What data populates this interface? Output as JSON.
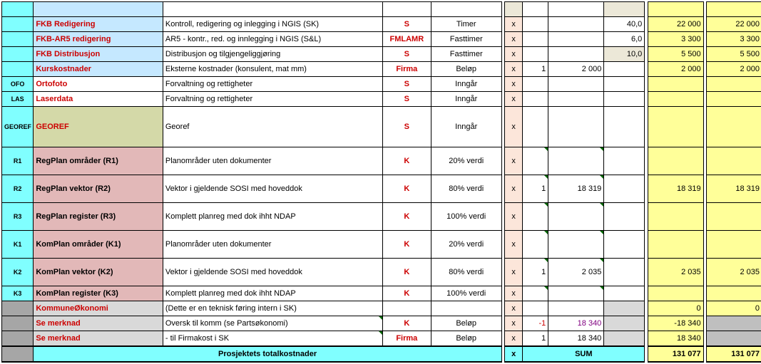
{
  "rows": [
    {
      "code": "",
      "codeBg": "bg-cyan",
      "name": "",
      "nameBg": "bg-lblue",
      "nameRed": false,
      "desc": "",
      "who": "",
      "unit": "",
      "x": "",
      "xBg": "bg-cream",
      "n1": "",
      "n2": "",
      "n3": "",
      "n3Bg": "bg-cream",
      "n4": "",
      "n4Bg": "bg-yellow",
      "n5": "",
      "n5Bg": "bg-yellow",
      "h": ""
    },
    {
      "code": "",
      "codeBg": "bg-cyan",
      "name": "FKB Redigering",
      "nameBg": "bg-lblue",
      "nameRed": true,
      "desc": "Kontroll, redigering og inlegging i NGIS (SK)",
      "who": "S",
      "unit": "Timer",
      "x": "x",
      "xBg": "bg-peach",
      "n1": "",
      "n2": "",
      "n3": "40,0",
      "n3Bg": "bg-white",
      "n4": "22 000",
      "n4Bg": "bg-yellow",
      "n5": "22 000",
      "n5Bg": "bg-yellow",
      "h": ""
    },
    {
      "code": "",
      "codeBg": "bg-cyan",
      "name": "FKB-AR5 redigering",
      "nameBg": "bg-lblue",
      "nameRed": true,
      "desc": "AR5 - kontr., red. og innlegging i NGIS (S&L)",
      "who": "FMLAMR",
      "unit": "Fasttimer",
      "x": "x",
      "xBg": "bg-peach",
      "n1": "",
      "n2": "",
      "n3": "6,0",
      "n3Bg": "bg-white",
      "n4": "3 300",
      "n4Bg": "bg-yellow",
      "n5": "3 300",
      "n5Bg": "bg-yellow",
      "h": ""
    },
    {
      "code": "",
      "codeBg": "bg-cyan",
      "name": "FKB Distribusjon",
      "nameBg": "bg-lblue",
      "nameRed": true,
      "desc": "Distribusjon og tilgjengeliggjøring",
      "who": "S",
      "unit": "Fasttimer",
      "x": "x",
      "xBg": "bg-peach",
      "n1": "",
      "n2": "",
      "n3": "10,0",
      "n3Bg": "bg-cream",
      "n4": "5 500",
      "n4Bg": "bg-yellow",
      "n5": "5 500",
      "n5Bg": "bg-yellow",
      "h": ""
    },
    {
      "code": "",
      "codeBg": "bg-cyan",
      "name": "Kurskostnader",
      "nameBg": "bg-lblue",
      "nameRed": true,
      "desc": "Eksterne kostnader (konsulent, mat mm)",
      "who": "Firma",
      "unit": "Beløp",
      "x": "x",
      "xBg": "bg-peach",
      "n1": "1",
      "n2": "2 000",
      "n3": "",
      "n3Bg": "bg-white",
      "n4": "2 000",
      "n4Bg": "bg-yellow",
      "n5": "2 000",
      "n5Bg": "bg-yellow",
      "h": ""
    },
    {
      "code": "OFO",
      "codeBg": "bg-cyan",
      "name": "Ortofoto",
      "nameBg": "bg-white",
      "nameRed": true,
      "desc": "Forvaltning og rettigheter",
      "who": "S",
      "unit": "Inngår",
      "x": "x",
      "xBg": "bg-peach",
      "n1": "",
      "n2": "",
      "n3": "",
      "n3Bg": "bg-white",
      "n4": "",
      "n4Bg": "bg-yellow",
      "n5": "",
      "n5Bg": "bg-yellow",
      "h": ""
    },
    {
      "code": "LAS",
      "codeBg": "bg-cyan",
      "name": "Laserdata",
      "nameBg": "bg-white",
      "nameRed": true,
      "desc": "Forvaltning og rettigheter",
      "who": "S",
      "unit": "Inngår",
      "x": "x",
      "xBg": "bg-peach",
      "n1": "",
      "n2": "",
      "n3": "",
      "n3Bg": "bg-white",
      "n4": "",
      "n4Bg": "bg-yellow",
      "n5": "",
      "n5Bg": "bg-yellow",
      "h": ""
    },
    {
      "code": "GEOREF",
      "codeBg": "bg-cyan",
      "name": "GEOREF",
      "nameBg": "bg-olive",
      "nameRed": true,
      "desc": "Georef",
      "who": "S",
      "unit": "Inngår",
      "x": "x",
      "xBg": "bg-peach",
      "n1": "",
      "n2": "",
      "n3": "",
      "n3Bg": "bg-white",
      "n4": "",
      "n4Bg": "bg-yellow",
      "n5": "",
      "n5Bg": "bg-yellow",
      "h": "tall"
    },
    {
      "code": "R1",
      "codeBg": "bg-cyan",
      "name": "RegPlan områder (R1)",
      "nameBg": "bg-rose",
      "nameRed": false,
      "desc": "Planområder uten dokumenter",
      "who": "K",
      "unit": "20% verdi",
      "x": "x",
      "xBg": "bg-peach",
      "n1": "",
      "n2": "",
      "n3": "",
      "n3Bg": "bg-white",
      "n4": "",
      "n4Bg": "bg-yellow",
      "n5": "",
      "n5Bg": "bg-yellow",
      "h": "med",
      "tri": true
    },
    {
      "code": "R2",
      "codeBg": "bg-cyan",
      "name": "RegPlan vektor (R2)",
      "nameBg": "bg-rose",
      "nameRed": false,
      "desc": "Vektor i gjeldende SOSI med hoveddok",
      "who": "K",
      "unit": "80% verdi",
      "x": "x",
      "xBg": "bg-peach",
      "n1": "1",
      "n2": "18 319",
      "n3": "",
      "n3Bg": "bg-white",
      "n4": "18 319",
      "n4Bg": "bg-yellow",
      "n5": "18 319",
      "n5Bg": "bg-yellow",
      "h": "med",
      "tri": true
    },
    {
      "code": "R3",
      "codeBg": "bg-cyan",
      "name": "RegPlan register (R3)",
      "nameBg": "bg-rose",
      "nameRed": false,
      "desc": "Komplett planreg med dok ihht NDAP",
      "who": "K",
      "unit": "100% verdi",
      "x": "x",
      "xBg": "bg-peach",
      "n1": "",
      "n2": "",
      "n3": "",
      "n3Bg": "bg-white",
      "n4": "",
      "n4Bg": "bg-yellow",
      "n5": "",
      "n5Bg": "bg-yellow",
      "h": "med",
      "tri": true
    },
    {
      "code": "K1",
      "codeBg": "bg-cyan",
      "name": "KomPlan områder (K1)",
      "nameBg": "bg-rose",
      "nameRed": false,
      "desc": "Planområder uten dokumenter",
      "who": "K",
      "unit": "20% verdi",
      "x": "x",
      "xBg": "bg-peach",
      "n1": "",
      "n2": "",
      "n3": "",
      "n3Bg": "bg-white",
      "n4": "",
      "n4Bg": "bg-yellow",
      "n5": "",
      "n5Bg": "bg-yellow",
      "h": "med",
      "tri": true
    },
    {
      "code": "K2",
      "codeBg": "bg-cyan",
      "name": "KomPlan vektor (K2)",
      "nameBg": "bg-rose",
      "nameRed": false,
      "desc": "Vektor i gjeldende SOSI med hoveddok",
      "who": "K",
      "unit": "80% verdi",
      "x": "x",
      "xBg": "bg-peach",
      "n1": "1",
      "n2": "2 035",
      "n3": "",
      "n3Bg": "bg-white",
      "n4": "2 035",
      "n4Bg": "bg-yellow",
      "n5": "2 035",
      "n5Bg": "bg-yellow",
      "h": "med",
      "tri": true
    },
    {
      "code": "K3",
      "codeBg": "bg-cyan",
      "name": "KomPlan register (K3)",
      "nameBg": "bg-rose",
      "nameRed": false,
      "desc": "Komplett planreg med dok ihht NDAP",
      "who": "K",
      "unit": "100% verdi",
      "x": "x",
      "xBg": "bg-peach",
      "n1": "",
      "n2": "",
      "n3": "",
      "n3Bg": "bg-white",
      "n4": "",
      "n4Bg": "bg-yellow",
      "n5": "",
      "n5Bg": "bg-yellow",
      "h": "",
      "tri": true
    },
    {
      "code": "",
      "codeBg": "bg-dgray",
      "name": "KommuneØkonomi",
      "nameBg": "bg-lgray",
      "nameRed": true,
      "desc": "(Dette er en teknisk føring intern i SK)",
      "who": "",
      "unit": "",
      "x": "x",
      "xBg": "bg-peach",
      "n1": "",
      "n2": "",
      "n3": "",
      "n3Bg": "bg-lgray",
      "n4": "0",
      "n4Bg": "bg-yellow",
      "n5": "0",
      "n5Bg": "bg-yellow",
      "h": ""
    },
    {
      "code": "",
      "codeBg": "bg-dgray",
      "name": "Se merknad",
      "nameBg": "bg-lgray",
      "nameRed": true,
      "desc": "Oversk til komm (se Partsøkonomi)",
      "who": "K",
      "unit": "Beløp",
      "x": "x",
      "xBg": "bg-peach",
      "n1": "-1",
      "n1Cls": "red",
      "n2": "18 340",
      "n2Cls": "purple",
      "n3": "",
      "n3Bg": "bg-lgray",
      "n4": "-18 340",
      "n4Bg": "bg-yellow",
      "n5": "",
      "n5Bg": "bg-gray",
      "h": "",
      "descTri": true
    },
    {
      "code": "",
      "codeBg": "bg-dgray",
      "name": "Se merknad",
      "nameBg": "bg-lgray",
      "nameRed": true,
      "desc": "  - til Firmakost i SK",
      "who": "Firma",
      "unit": "Beløp",
      "x": "x",
      "xBg": "bg-peach",
      "n1": "1",
      "n2": "18 340",
      "n3": "",
      "n3Bg": "bg-lgray",
      "n4": "18 340",
      "n4Bg": "bg-yellow",
      "n5": "",
      "n5Bg": "bg-gray",
      "h": "",
      "descTri": true
    }
  ],
  "footer": {
    "title": "Prosjektets totalkostnader",
    "x": "x",
    "sum": "SUM",
    "t1": "131 077",
    "t2": "131 077"
  }
}
